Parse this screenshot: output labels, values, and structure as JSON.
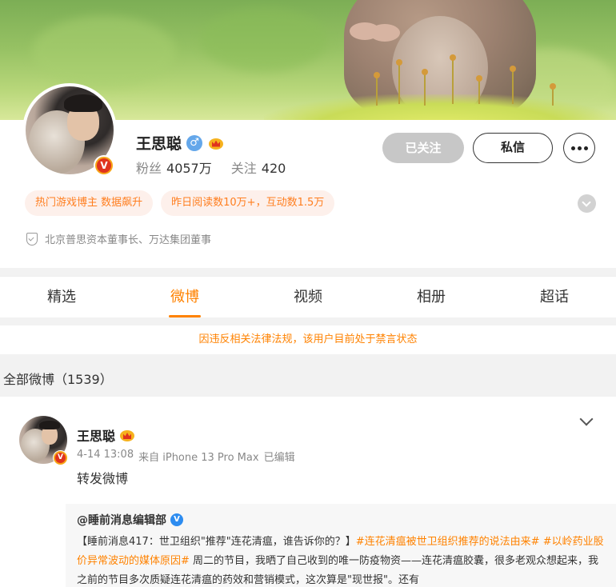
{
  "profile": {
    "name": "王思聪",
    "fans_label": "粉丝",
    "fans_count": "4057万",
    "following_label": "关注",
    "following_count": "420",
    "followed_button": "已关注",
    "message_button": "私信",
    "verified_badge": "V",
    "gender": "male",
    "gender_symbol": "♂",
    "tags": [
      "热门游戏博主 数据飙升",
      "昨日阅读数10万+，互动数1.5万"
    ],
    "certification": "北京普思资本董事长、万达集团董事"
  },
  "tabs": [
    {
      "label": "精选",
      "active": false
    },
    {
      "label": "微博",
      "active": true
    },
    {
      "label": "视频",
      "active": false
    },
    {
      "label": "相册",
      "active": false
    },
    {
      "label": "超话",
      "active": false
    }
  ],
  "notice": "因违反相关法律法规，该用户目前处于禁言状态",
  "feed": {
    "header": "全部微博（1539）"
  },
  "post": {
    "author": "王思聪",
    "time": "4-14 13:08",
    "source": "来自 iPhone 13 Pro Max",
    "edited": "已编辑",
    "text": "转发微博",
    "repost": {
      "author": "@睡前消息编辑部",
      "verified_badge": "V",
      "segments": [
        {
          "text": "【睡前消息417：世卫组织\"推荐\"连花清瘟，谁告诉你的？】",
          "topic": false
        },
        {
          "text": "#连花清瘟被世卫组织推荐的说法由来#",
          "topic": true
        },
        {
          "text": " ",
          "topic": false
        },
        {
          "text": "#以岭药业股价异常波动的媒体原因#",
          "topic": true
        },
        {
          "text": " 周二的节目，我晒了自己收到的唯一防疫物资——连花清瘟胶囊，很多老观众想起来，我之前的节目多次质疑连花清瘟的药效和营销模式，这次算是\"现世报\"。还有",
          "topic": false
        }
      ]
    }
  },
  "colors": {
    "accent": "#ff8200",
    "tag_bg": "#fdf0eb",
    "followed_bg": "#c7c7c7",
    "verified_gold": "#f7a617",
    "verified_red": "#e0331e",
    "blue_v": "#2d8cf0"
  },
  "icons": [
    "male-icon",
    "crown-icon",
    "verified-icon",
    "shield-icon",
    "more-icon",
    "chevron-down-icon"
  ]
}
